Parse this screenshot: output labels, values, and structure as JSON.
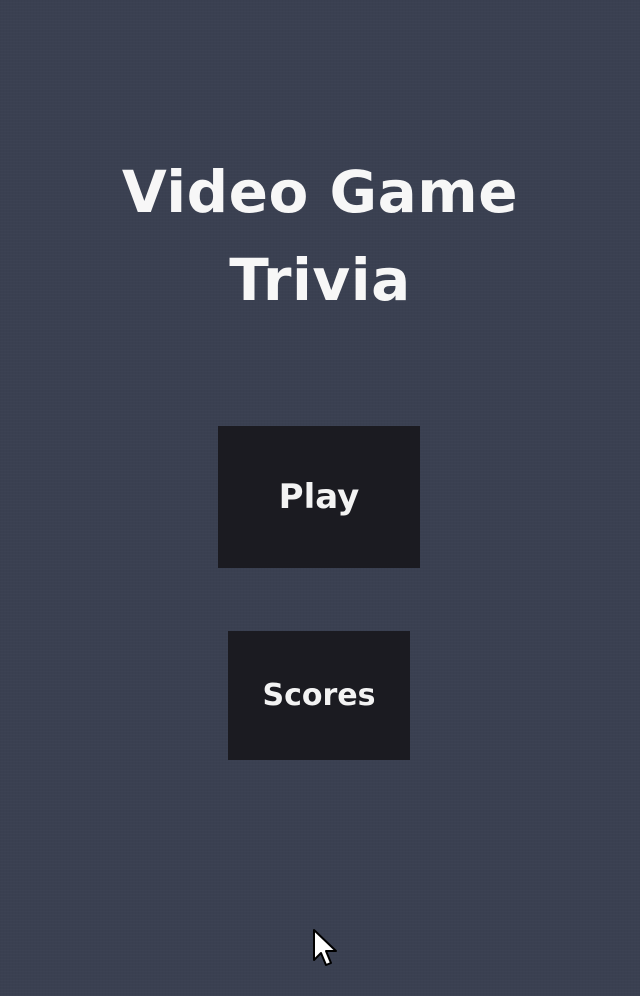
{
  "title": {
    "line1": "Video Game",
    "line2": "Trivia"
  },
  "menu": {
    "play_label": "Play",
    "scores_label": "Scores"
  },
  "colors": {
    "background": "#3a4051",
    "button_background": "#1b1b21",
    "text": "#f7f7f7"
  },
  "icons": {
    "cursor": "mouse-pointer-icon"
  }
}
